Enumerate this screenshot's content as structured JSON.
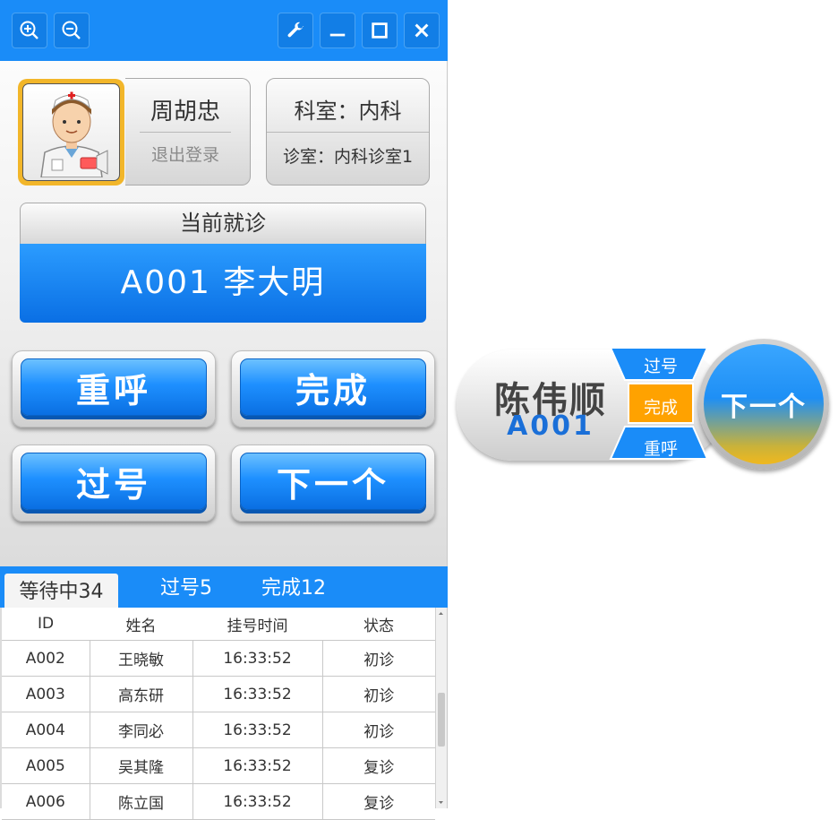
{
  "titlebar": {
    "zoom_in": "zoom-in",
    "zoom_out": "zoom-out",
    "settings": "wrench",
    "minimize": "minimize",
    "maximize": "maximize",
    "close": "close"
  },
  "doctor": {
    "name": "周胡忠",
    "logout": "退出登录"
  },
  "location": {
    "dept": "科室：内科",
    "room": "诊室：内科诊室1"
  },
  "current": {
    "header": "当前就诊",
    "patient": "A001 李大明"
  },
  "actions": {
    "recall": "重呼",
    "finish": "完成",
    "skip": "过号",
    "next": "下一个"
  },
  "tabs": [
    {
      "label": "等待中34"
    },
    {
      "label": "过号5"
    },
    {
      "label": "完成12"
    }
  ],
  "table": {
    "columns": [
      "ID",
      "姓名",
      "挂号时间",
      "状态"
    ],
    "rows": [
      [
        "A002",
        "王晓敏",
        "16:33:52",
        "初诊"
      ],
      [
        "A003",
        "高东研",
        "16:33:52",
        "初诊"
      ],
      [
        "A004",
        "李同必",
        "16:33:52",
        "初诊"
      ],
      [
        "A005",
        "吴其隆",
        "16:33:52",
        "复诊"
      ],
      [
        "A006",
        "陈立国",
        "16:33:52",
        "复诊"
      ]
    ]
  },
  "widget": {
    "name": "陈伟顺",
    "number": "A001",
    "skip": "过号",
    "finish": "完成",
    "recall": "重呼",
    "next": "下一个"
  },
  "colors": {
    "accent": "#1a8cf8",
    "finish_highlight": "#ffa200",
    "number_text": "#1a6fd8"
  }
}
